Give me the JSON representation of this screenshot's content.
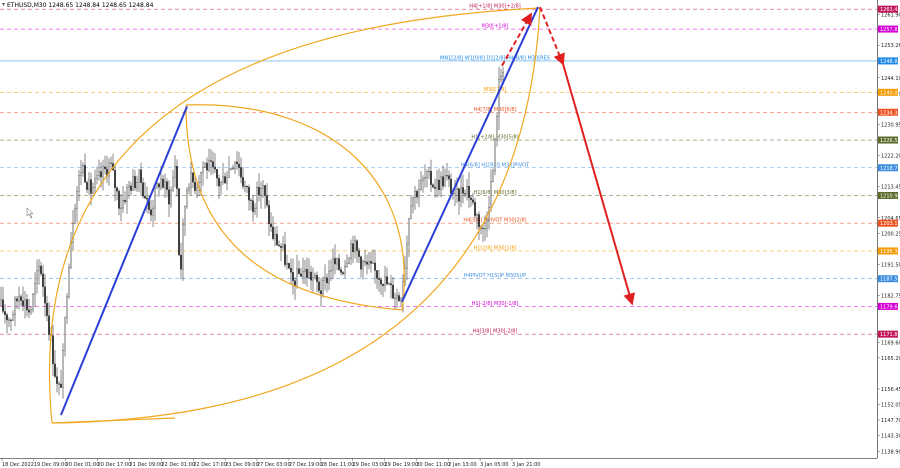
{
  "header": {
    "title": "ETHUSD,M30 1248.65 1248.84 1248.65 1248.84"
  },
  "chart_data": {
    "type": "candlestick",
    "symbol": "ETHUSD",
    "timeframe": "M30",
    "ohlc_header": [
      1248.65,
      1248.84,
      1248.65,
      1248.84
    ],
    "ylim": [
      1137.0,
      1266.0
    ],
    "y_ticks": [
      1261.9,
      1253.26,
      1244.1,
      1239.7,
      1230.95,
      1222.2,
      1213.45,
      1204.65,
      1200.25,
      1191.5,
      1182.75,
      1169.6,
      1165.2,
      1156.45,
      1152.05,
      1147.7,
      1143.3,
      1138.9
    ],
    "x_ticks": [
      "18 Dec 2022",
      "19 Dec 09:00",
      "20 Dec 01:00",
      "20 Dec 17:00",
      "21 Dec 09:00",
      "22 Dec 01:00",
      "22 Dec 17:00",
      "23 Dec 09:00",
      "27 Dec 03:00",
      "27 Dec 19:00",
      "28 Dec 11:00",
      "29 Dec 03:00",
      "29 Dec 19:00",
      "30 Dec 11:00",
      "2 Jan 13:00",
      "3 Jan 05:00",
      "3 Jan 21:00"
    ],
    "price_badges": [
      {
        "value": "1263.42",
        "color": "#c2185b"
      },
      {
        "value": "1257.81",
        "color": "#d500d5"
      },
      {
        "value": "1248.84",
        "color": "#1e88e5"
      },
      {
        "value": "1240.00",
        "color": "#f59b00"
      },
      {
        "value": "1234.38",
        "color": "#ef5322"
      },
      {
        "value": "1226.56",
        "color": "#5a6b2a"
      },
      {
        "value": "1218.75",
        "color": "#3d8ee0"
      },
      {
        "value": "1210.94",
        "color": "#5a6b2a"
      },
      {
        "value": "1203.13",
        "color": "#ef5322"
      },
      {
        "value": "1195.31",
        "color": "#f59b00"
      },
      {
        "value": "1187.50",
        "color": "#3d8ee0"
      },
      {
        "value": "1179.69",
        "color": "#d500d5"
      },
      {
        "value": "1171.88",
        "color": "#c2185b"
      }
    ],
    "levels": [
      {
        "label": "H4[+1/8] M30[+2/8]",
        "price": 1263.42,
        "color": "#c2185b",
        "dash": "4,3"
      },
      {
        "label": "M30[+1/8]",
        "price": 1257.81,
        "color": "#d500d5",
        "dash": "4,3"
      },
      {
        "label": "MN1[2/8] W1[0/8] D1[2/8] H4[8/8] M30[RES",
        "price": 1248.84,
        "color": "#1e88e5",
        "dash": ""
      },
      {
        "label": "M30[7/8]",
        "price": 1240.0,
        "color": "#f59b00",
        "dash": "4,3"
      },
      {
        "label": "H4[7/8] M30[6/8]",
        "price": 1234.38,
        "color": "#ef5322",
        "dash": "4,3"
      },
      {
        "label": "H1[+2/8] M30[5/8]",
        "price": 1226.56,
        "color": "#5a6b2a",
        "dash": "4,3"
      },
      {
        "label": "H4[6/8] H1[RES M30]PIVOT",
        "price": 1218.75,
        "color": "#3d8ee0",
        "dash": "4,3"
      },
      {
        "label": "H1[6/8] M30[3/8]",
        "price": 1210.94,
        "color": "#5a6b2a",
        "dash": "4,3"
      },
      {
        "label": "H4[5/8] HPIVOT M30[2/8]",
        "price": 1203.13,
        "color": "#ef5322",
        "dash": "4,3"
      },
      {
        "label": "H1[2/8] M30[1/8]",
        "price": 1195.31,
        "color": "#f59b00",
        "dash": "4,3"
      },
      {
        "label": "H4PIVOT H1SUP M30SUP",
        "price": 1187.5,
        "color": "#3d8ee0",
        "dash": "4,3"
      },
      {
        "label": "H1[-2/8] M30[-1/8]",
        "price": 1179.69,
        "color": "#d500d5",
        "dash": "4,3"
      },
      {
        "label": "H4[3/8] M30[-2/8]",
        "price": 1171.88,
        "color": "#c2185b",
        "dash": "4,3"
      }
    ],
    "impulse_lines": [
      {
        "from": [
          5,
          1149.5
        ],
        "to": [
          184,
          1236.0
        ],
        "color": "#2a3fd6"
      },
      {
        "from": [
          402,
          1181.0
        ],
        "to": [
          538,
          1264.0
        ],
        "color": "#2a3fd6"
      }
    ],
    "forecast": {
      "dashed": {
        "from": [
          502,
          1247.5
        ],
        "to": [
          531,
          1262.0
        ],
        "color": "#e02020"
      },
      "dashed_down": {
        "from": [
          540,
          1264.0
        ],
        "to": [
          563,
          1248.0
        ],
        "color": "#e02020"
      },
      "solid": {
        "from": [
          563,
          1248.0
        ],
        "to": [
          632,
          1180.5
        ],
        "color": "#e02020"
      }
    },
    "arc_color": "#f0a820"
  }
}
